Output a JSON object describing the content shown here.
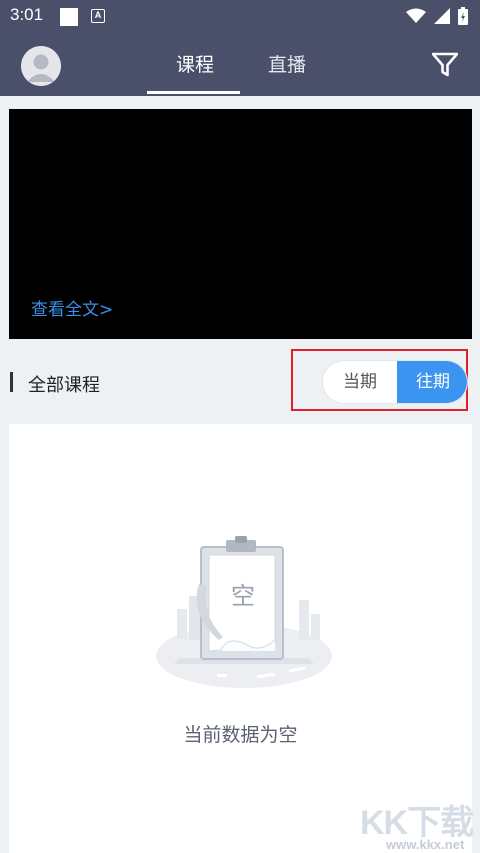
{
  "status_bar": {
    "time": "3:01",
    "notif_badge": "A"
  },
  "header": {
    "tabs": [
      {
        "label": "课程",
        "active": true
      },
      {
        "label": "直播",
        "active": false
      }
    ]
  },
  "video": {
    "link_text": "查看全文>"
  },
  "section": {
    "title": "全部课程",
    "toggle": {
      "current_label": "当期",
      "past_label": "往期",
      "selected": "往期"
    }
  },
  "empty_state": {
    "illustration_text": "空",
    "message": "当前数据为空"
  },
  "watermark": {
    "logo": "KK下载",
    "url": "www.kkx.net"
  },
  "colors": {
    "header_bg": "#4a5069",
    "accent": "#3a94f0",
    "link": "#3a8ee8",
    "highlight": "#e0202a"
  }
}
